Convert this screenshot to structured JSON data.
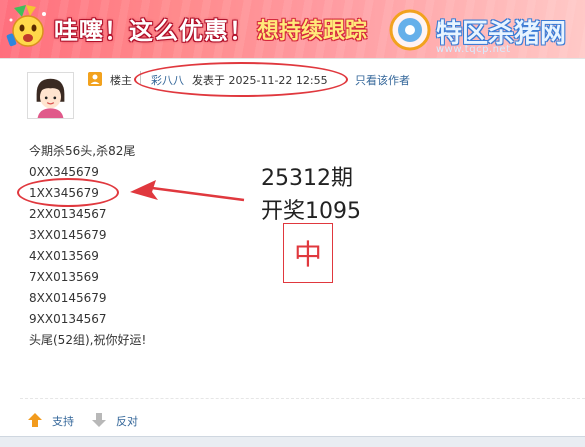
{
  "banner": {
    "main_text": "哇噻！这么优惠！",
    "sub_text": "想持续跟踪",
    "watermark_name": "特区杀猪网",
    "watermark_url": "www.tqcp.net",
    "mascot_icon": "party-mascot-icon",
    "logo_icon": "site-logo-icon"
  },
  "post": {
    "author_label": "楼主",
    "author_name": "彩八八",
    "posted_prefix": "发表于",
    "posted_time": "2025-11-22 12:55",
    "only_author_label": "只看该作者",
    "lines": [
      "今期杀56头,杀82尾",
      "0XX345679",
      "1XX345679",
      "2XX0134567",
      "3XX0145679",
      "4XX013569",
      "7XX013569",
      "8XX0145679",
      "9XX0134567",
      "头尾(52组),祝你好运!"
    ]
  },
  "annotation": {
    "period": "25312期",
    "draw": "开奖1095",
    "hit_mark": "中",
    "accent_color": "#e0383e"
  },
  "actions": {
    "support_label": "支持",
    "oppose_label": "反对"
  }
}
